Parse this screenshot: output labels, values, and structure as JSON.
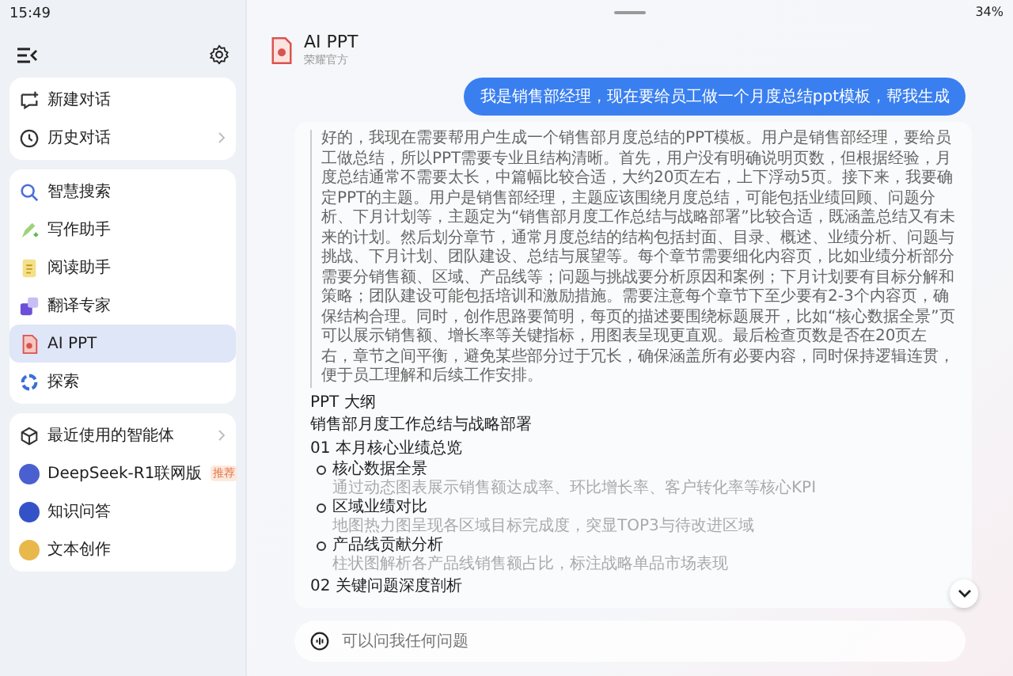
{
  "status_bar": {
    "time": "15:49",
    "battery": "34%"
  },
  "sidebar": {
    "groups": [
      {
        "items": [
          {
            "label": "新建对话",
            "chevron": false,
            "selected": false
          },
          {
            "label": "历史对话",
            "chevron": true,
            "selected": false
          }
        ]
      },
      {
        "items": [
          {
            "label": "智慧搜索",
            "chevron": false,
            "selected": false
          },
          {
            "label": "写作助手",
            "chevron": false,
            "selected": false
          },
          {
            "label": "阅读助手",
            "chevron": false,
            "selected": false
          },
          {
            "label": "翻译专家",
            "chevron": false,
            "selected": false
          },
          {
            "label": "AI PPT",
            "chevron": false,
            "selected": true
          },
          {
            "label": "探索",
            "chevron": false,
            "selected": false
          }
        ]
      },
      {
        "items": [
          {
            "label": "最近使用的智能体",
            "chevron": true,
            "selected": false
          },
          {
            "label": "DeepSeek-R1联网版",
            "chevron": false,
            "selected": false,
            "badge": "推荐"
          },
          {
            "label": "知识问答",
            "chevron": false,
            "selected": false
          },
          {
            "label": "文本创作",
            "chevron": false,
            "selected": false
          }
        ]
      }
    ]
  },
  "header": {
    "title": "AI PPT",
    "subtitle": "荣耀官方"
  },
  "user_message": "我是销售部经理，现在要给员工做一个月度总结ppt模板，帮我生成",
  "reply": {
    "reasoning": "好的，我现在需要帮用户生成一个销售部月度总结的PPT模板。用户是销售部经理，要给员工做总结，所以PPT需要专业且结构清晰。首先，用户没有明确说明页数，但根据经验，月度总结通常不需要太长，中篇幅比较合适，大约20页左右，上下浮动5页。接下来，我要确定PPT的主题。用户是销售部经理，主题应该围绕月度总结，可能包括业绩回顾、问题分析、下月计划等，主题定为“销售部月度工作总结与战略部署”比较合适，既涵盖总结又有未来的计划。然后划分章节，通常月度总结的结构包括封面、目录、概述、业绩分析、问题与挑战、下月计划、团队建设、总结与展望等。每个章节需要细化内容页，比如业绩分析部分需要分销售额、区域、产品线等；问题与挑战要分析原因和案例；下月计划要有目标分解和策略；团队建设可能包括培训和激励措施。需要注意每个章节下至少要有2-3个内容页，确保结构合理。同时，创作思路要简明，每页的描述要围绕标题展开，比如“核心数据全景”页可以展示销售额、增长率等关键指标，用图表呈现更直观。最后检查页数是否在20页左右，章节之间平衡，避免某些部分过于冗长，确保涵盖所有必要内容，同时保持逻辑连贯，便于员工理解和后续工作安排。",
    "outline_label": "PPT 大纲",
    "outline_title": "销售部月度工作总结与战略部署",
    "sections": [
      {
        "heading": "01 本月核心业绩总览",
        "items": [
          {
            "title": "核心数据全景",
            "desc": "通过动态图表展示销售额达成率、环比增长率、客户转化率等核心KPI"
          },
          {
            "title": "区域业绩对比",
            "desc": "地图热力图呈现各区域目标完成度，突显TOP3与待改进区域"
          },
          {
            "title": "产品线贡献分析",
            "desc": "柱状图解析各产品线销售额占比，标注战略单品市场表现"
          }
        ]
      },
      {
        "heading": "02 关键问题深度剖析"
      }
    ]
  },
  "input": {
    "placeholder": "可以问我任何问题"
  }
}
